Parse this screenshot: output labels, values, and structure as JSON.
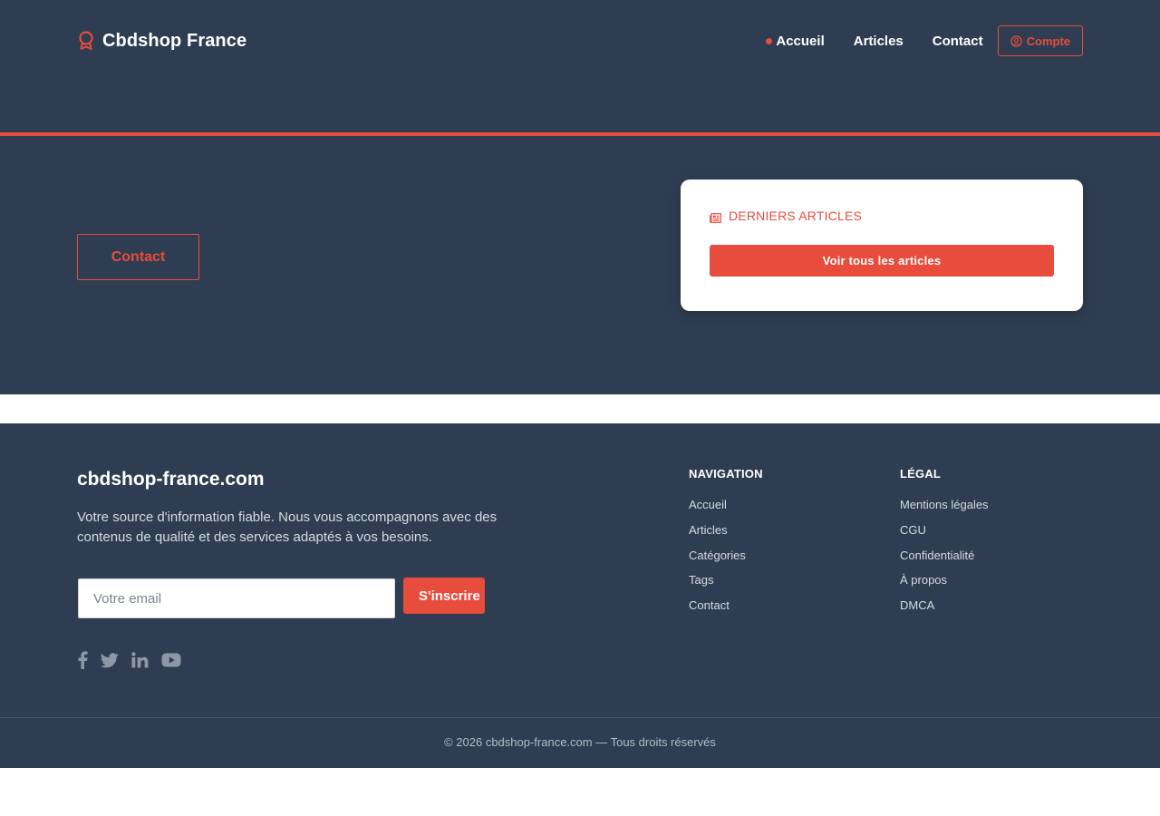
{
  "header": {
    "brand_name": "Cbdshop France",
    "brand_icon": "award-icon",
    "nav": [
      {
        "label": "Accueil",
        "active": true
      },
      {
        "label": "Articles",
        "active": false
      },
      {
        "label": "Contact",
        "active": false
      }
    ],
    "account_label": "Compte",
    "account_icon": "user-circle-icon"
  },
  "hero": {
    "contact_label": "Contact",
    "card": {
      "title": "DERNIERS ARTICLES",
      "title_icon": "newspaper-icon",
      "button_label": "Voir tous les articles"
    }
  },
  "footer": {
    "site_name": "cbdshop-france.com",
    "description": "Votre source d'information fiable. Nous vous accompagnons avec des contenus de qualité et des services adaptés à vos besoins.",
    "newsletter": {
      "placeholder": "Votre email",
      "button_label": "S'inscrire"
    },
    "socials": [
      "facebook-icon",
      "twitter-icon",
      "linkedin-icon",
      "youtube-icon"
    ],
    "navigation": {
      "title": "NAVIGATION",
      "links": [
        "Accueil",
        "Articles",
        "Catégories",
        "Tags",
        "Contact"
      ]
    },
    "legal": {
      "title": "LÉGAL",
      "links": [
        "Mentions légales",
        "CGU",
        "Confidentialité",
        "À propos",
        "DMCA"
      ]
    },
    "copyright": "© 2026 cbdshop-france.com — Tous droits réservés"
  },
  "colors": {
    "background_dark": "#2e3d51",
    "accent": "#e74c3c",
    "text_light": "#d6dbe2"
  }
}
